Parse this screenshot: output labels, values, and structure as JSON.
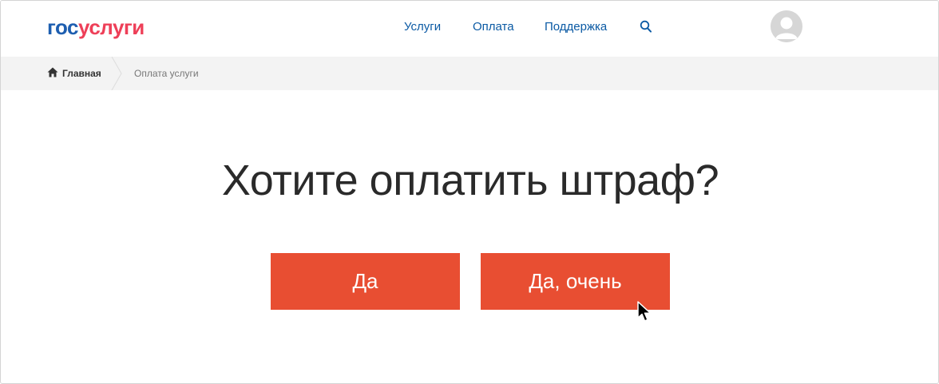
{
  "header": {
    "logo_part1": "гос",
    "logo_part2": "услуги",
    "nav": [
      {
        "label": "Услуги"
      },
      {
        "label": "Оплата"
      },
      {
        "label": "Поддержка"
      }
    ],
    "search_icon": "search-icon",
    "avatar_icon": "user-avatar"
  },
  "breadcrumb": {
    "home_label": "Главная",
    "current_label": "Оплата услуги"
  },
  "main": {
    "question": "Хотите оплатить штраф?",
    "buttons": [
      {
        "label": "Да"
      },
      {
        "label": "Да, очень"
      }
    ]
  },
  "colors": {
    "brand_blue": "#1d5eb0",
    "brand_red": "#ee3f58",
    "link_blue": "#0b5aa4",
    "button_orange": "#e84e32",
    "breadcrumb_bg": "#f3f3f3"
  }
}
